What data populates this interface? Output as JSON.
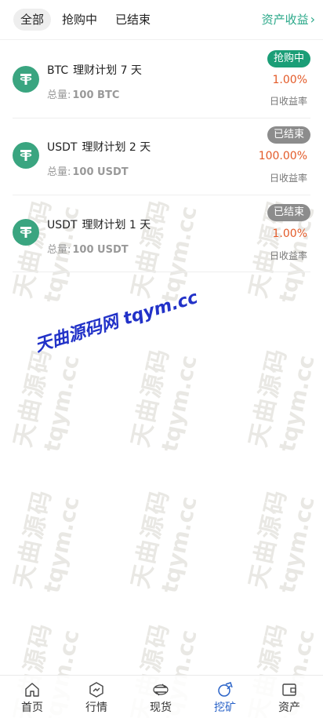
{
  "tabs": [
    {
      "label": "全部",
      "active": true
    },
    {
      "label": "抢购中",
      "active": false
    },
    {
      "label": "已结束",
      "active": false
    }
  ],
  "asset_link": {
    "label": "资产收益",
    "icon": "chevron-right-icon"
  },
  "plans": [
    {
      "coin": "BTC",
      "name": "理财计划 7 天",
      "total_label": "总量:",
      "total_value": "100 BTC",
      "status": "抢购中",
      "status_color": "#1b9e77",
      "rate": "1.00%",
      "rate_label": "日收益率",
      "icon": "tether-icon"
    },
    {
      "coin": "USDT",
      "name": "理财计划 2 天",
      "total_label": "总量:",
      "total_value": "100 USDT",
      "status": "已结束",
      "status_color": "#8c8c8c",
      "rate": "100.00%",
      "rate_label": "日收益率",
      "icon": "tether-icon"
    },
    {
      "coin": "USDT",
      "name": "理财计划 1 天",
      "total_label": "总量:",
      "total_value": "100 USDT",
      "status": "已结束",
      "status_color": "#8c8c8c",
      "rate": "1.00%",
      "rate_label": "日收益率",
      "icon": "tether-icon"
    }
  ],
  "watermark": {
    "main": "天曲源码网 tqym.cc",
    "cn": "天曲源码",
    "en": "tqym.cc"
  },
  "bottom_nav": [
    {
      "label": "首页",
      "icon": "home-icon",
      "active": false
    },
    {
      "label": "行情",
      "icon": "market-icon",
      "active": false
    },
    {
      "label": "现货",
      "icon": "exchange-icon",
      "active": false
    },
    {
      "label": "挖矿",
      "icon": "mining-icon",
      "active": true
    },
    {
      "label": "资产",
      "icon": "wallet-icon",
      "active": false
    }
  ],
  "colors": {
    "accent_green": "#2aa889",
    "rate_orange": "#e35a28",
    "nav_active": "#2a63c8"
  }
}
